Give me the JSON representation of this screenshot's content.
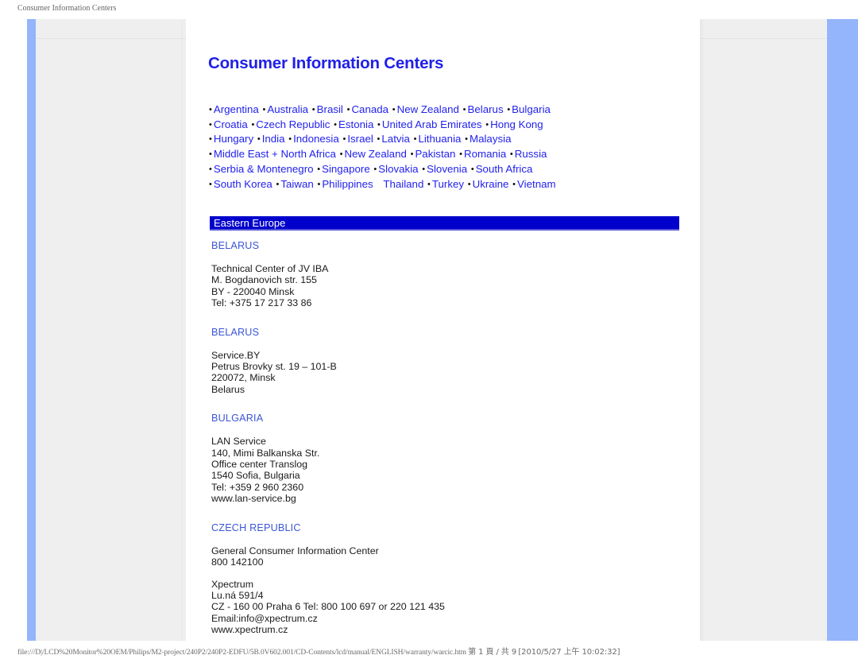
{
  "browser_header": {
    "title": "Consumer Information Centers"
  },
  "browser_footer": {
    "url": "file:///D|/LCD%20Monitor%20OEM/Philips/M2-project/240P2/240P2-EDFU/5B.0V602.001/CD-Contents/lcd/manual/ENGLISH/warranty/warcic.htm",
    "pagination": "第 1 頁 / 共 9",
    "timestamp": "[2010/5/27 上午 10:02:32]"
  },
  "page": {
    "title": "Consumer Information Centers",
    "link_rows": [
      [
        "Argentina",
        "Australia",
        "Brasil",
        "Canada",
        "New Zealand",
        "Belarus",
        "Bulgaria"
      ],
      [
        "Croatia",
        "Czech Republic",
        "Estonia",
        "United Arab Emirates",
        "Hong Kong"
      ],
      [
        "Hungary",
        "India",
        "Indonesia",
        "Israel",
        "Latvia",
        "Lithuania",
        "Malaysia"
      ],
      [
        "Middle East + North Africa",
        "New Zealand",
        "Pakistan",
        "Romania",
        "Russia"
      ],
      [
        "Serbia & Montenegro",
        "Singapore",
        "Slovakia",
        "Slovenia",
        "South Africa"
      ],
      [
        "South Korea",
        "Taiwan",
        "Philippines",
        "Thailand",
        "Turkey",
        "Ukraine",
        "Vietnam"
      ]
    ],
    "section_bar": {
      "label": "Eastern Europe",
      "background": "#0000cc",
      "text_color": "#ffffff"
    },
    "entries": [
      {
        "country": "BELARUS",
        "lines": [
          "Technical Center of JV IBA",
          "M. Bogdanovich str. 155",
          "BY - 220040 Minsk",
          "Tel: +375 17 217 33 86"
        ]
      },
      {
        "country": "BELARUS",
        "lines": [
          "Service.BY",
          "Petrus Brovky st. 19 – 101-B",
          "220072, Minsk",
          "Belarus"
        ]
      },
      {
        "country": "BULGARIA",
        "lines": [
          "LAN Service",
          "140, Mimi Balkanska Str.",
          "Office center Translog",
          "1540 Sofia, Bulgaria",
          "Tel: +359 2 960 2360",
          "www.lan-service.bg"
        ]
      },
      {
        "country": "CZECH REPUBLIC",
        "lines": [
          "General Consumer Information Center",
          "800 142100",
          "",
          "Xpectrum",
          "Lu.ná 591/4",
          "CZ - 160 00 Praha 6 Tel: 800 100 697 or 220 121 435",
          "Email:info@xpectrum.cz",
          "www.xpectrum.cz"
        ]
      }
    ],
    "colors": {
      "link": "#2222ee",
      "title": "#2020e8",
      "entry_title": "#3b56d6",
      "rail": "#94b4fb",
      "panel": "#efefef"
    }
  }
}
